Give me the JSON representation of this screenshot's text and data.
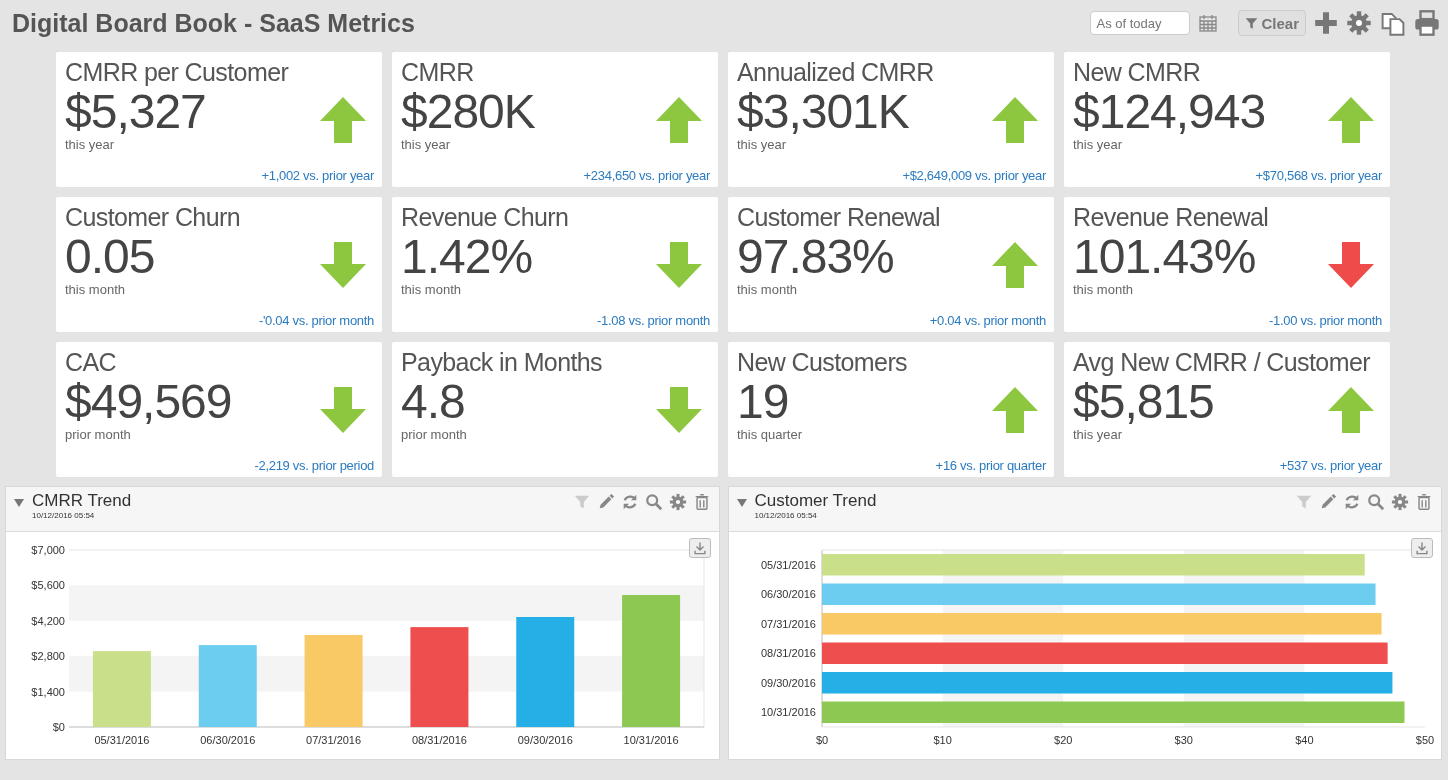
{
  "title": "Digital Board Book - SaaS Metrics",
  "toolbar": {
    "date_placeholder": "As of today",
    "clear_label": "Clear"
  },
  "metrics": [
    {
      "title": "CMRR per Customer",
      "value": "$5,327",
      "period": "this year",
      "change": "+1,002 vs. prior year",
      "kind": "up",
      "color": "#8dc63f"
    },
    {
      "title": "CMRR",
      "value": "$280K",
      "period": "this year",
      "change": "+234,650 vs. prior year",
      "kind": "up",
      "color": "#8dc63f"
    },
    {
      "title": "Annualized CMRR",
      "value": "$3,301K",
      "period": "this year",
      "change": "+$2,649,009 vs. prior year",
      "kind": "up",
      "color": "#8dc63f"
    },
    {
      "title": "New CMRR",
      "value": "$124,943",
      "period": "this year",
      "change": "+$70,568 vs. prior year",
      "kind": "up",
      "color": "#8dc63f"
    },
    {
      "title": "Customer Churn",
      "value": "0.05",
      "period": "this month",
      "change": "-'0.04 vs. prior month",
      "kind": "down",
      "color": "#8dc63f"
    },
    {
      "title": "Revenue Churn",
      "value": "1.42%",
      "period": "this month",
      "change": "-1.08 vs. prior month",
      "kind": "down",
      "color": "#8dc63f"
    },
    {
      "title": "Customer Renewal",
      "value": "97.83%",
      "period": "this month",
      "change": "+0.04 vs. prior month",
      "kind": "up",
      "color": "#8dc63f"
    },
    {
      "title": "Revenue Renewal",
      "value": "101.43%",
      "period": "this month",
      "change": "-1.00 vs. prior month",
      "kind": "down",
      "color": "#ef4b4b"
    },
    {
      "title": "CAC",
      "value": "$49,569",
      "period": "prior month",
      "change": "-2,219 vs. prior period",
      "kind": "down",
      "color": "#8dc63f"
    },
    {
      "title": "Payback in Months",
      "value": "4.8",
      "period": "prior month",
      "kind": "down",
      "color": "#8dc63f"
    },
    {
      "title": "New Customers",
      "value": "19",
      "period": "this quarter",
      "change": "+16 vs. prior quarter",
      "kind": "up",
      "color": "#8dc63f"
    },
    {
      "title": "Avg New CMRR / Customer",
      "value": "$5,815",
      "period": "this year",
      "change": "+537 vs. prior year",
      "kind": "up",
      "color": "#8dc63f"
    }
  ],
  "panels": [
    {
      "title": "CMRR Trend",
      "timestamp": "10/12/2016 05:54",
      "chart_data": {
        "type": "bar",
        "orientation": "vertical",
        "categories": [
          "05/31/2016",
          "06/30/2016",
          "07/31/2016",
          "08/31/2016",
          "09/30/2016",
          "10/31/2016"
        ],
        "colors": [
          "#c9df8a",
          "#6ccdf0",
          "#f8c965",
          "#ef4e4e",
          "#26aee6",
          "#8dc852"
        ],
        "values": [
          3000,
          3240,
          3640,
          3950,
          4350,
          5220
        ],
        "ylim": [
          0,
          7000
        ],
        "yticks": [
          {
            "value": 0,
            "label": "$0"
          },
          {
            "value": 1400,
            "label": "$1,400"
          },
          {
            "value": 2800,
            "label": "$2,800"
          },
          {
            "value": 4200,
            "label": "$4,200"
          },
          {
            "value": 5600,
            "label": "$5,600"
          },
          {
            "value": 7000,
            "label": "$7,000"
          }
        ]
      }
    },
    {
      "title": "Customer Trend",
      "timestamp": "10/12/2016 05:54",
      "chart_data": {
        "type": "bar",
        "orientation": "horizontal",
        "categories": [
          "05/31/2016",
          "06/30/2016",
          "07/31/2016",
          "08/31/2016",
          "09/30/2016",
          "10/31/2016"
        ],
        "colors": [
          "#c9df8a",
          "#6ccdf0",
          "#f8c965",
          "#ef4e4e",
          "#26aee6",
          "#8dc852"
        ],
        "values": [
          45.0,
          45.9,
          46.4,
          46.9,
          47.3,
          48.3
        ],
        "xlim": [
          0,
          50
        ],
        "xticks": [
          {
            "value": 0,
            "label": "$0"
          },
          {
            "value": 10,
            "label": "$10"
          },
          {
            "value": 20,
            "label": "$20"
          },
          {
            "value": 30,
            "label": "$30"
          },
          {
            "value": 40,
            "label": "$40"
          },
          {
            "value": 50,
            "label": "$50"
          }
        ]
      }
    }
  ]
}
